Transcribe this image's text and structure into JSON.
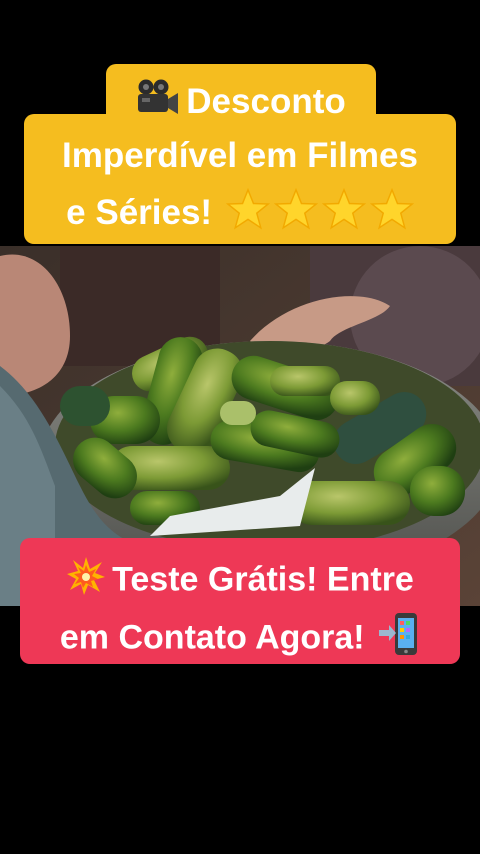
{
  "video": {
    "scene": "pickles"
  },
  "top_caption": {
    "line1": "Desconto",
    "line2": "Imperdível em Filmes",
    "line3": "e Séries!",
    "icon": "movie-camera-icon",
    "rating_icon": "star-icon",
    "star_count": 4,
    "background_color": "#f5bd1f"
  },
  "bottom_caption": {
    "line1": "Teste Grátis! Entre",
    "line2": "em Contato Agora!",
    "lead_icon": "explosion-icon",
    "trail_icon": "mobile-phone-arrow-icon",
    "background_color": "#ee3856"
  }
}
